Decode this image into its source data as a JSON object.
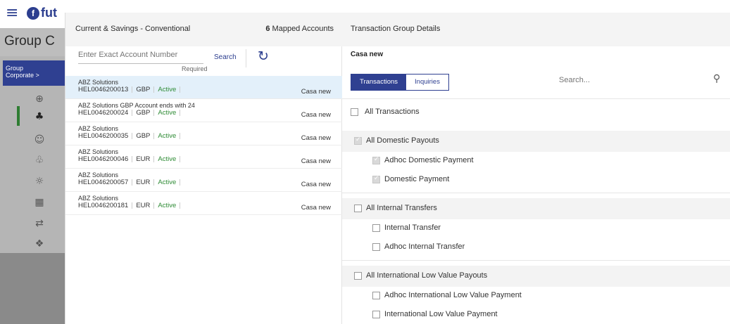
{
  "background": {
    "brand_text": "fut",
    "brand_mark": "f",
    "page_title": "Group C",
    "side_first_label_1": "Group",
    "side_first_label_2": "Corporate >",
    "side_icons": [
      "globe-icon",
      "users-icon",
      "user-badge-icon",
      "group-icon",
      "settings-icon",
      "calculator-icon",
      "transfer-icon",
      "puzzle-icon"
    ]
  },
  "left_pane": {
    "title": "Current & Savings - Conventional",
    "mapped_count": "6",
    "mapped_label": "Mapped Accounts",
    "account_input_placeholder": "Enter Exact Account Number",
    "required_label": "Required",
    "search_label": "Search",
    "accounts": [
      {
        "name": "ABZ Solutions",
        "number": "HEL0046200013",
        "currency": "GBP",
        "status": "Active",
        "group": "Casa new",
        "selected": true
      },
      {
        "name": "ABZ Solutions GBP Account ends with 24",
        "number": "HEL0046200024",
        "currency": "GBP",
        "status": "Active",
        "group": "Casa new",
        "selected": false
      },
      {
        "name": "ABZ Solutions",
        "number": "HEL0046200035",
        "currency": "GBP",
        "status": "Active",
        "group": "Casa new",
        "selected": false
      },
      {
        "name": "ABZ Solutions",
        "number": "HEL0046200046",
        "currency": "EUR",
        "status": "Active",
        "group": "Casa new",
        "selected": false
      },
      {
        "name": "ABZ Solutions",
        "number": "HEL0046200057",
        "currency": "EUR",
        "status": "Active",
        "group": "Casa new",
        "selected": false
      },
      {
        "name": "ABZ Solutions",
        "number": "HEL0046200181",
        "currency": "EUR",
        "status": "Active",
        "group": "Casa new",
        "selected": false
      }
    ]
  },
  "right_pane": {
    "title": "Transaction Group Details",
    "group_name": "Casa new",
    "tabs": [
      {
        "label": "Transactions",
        "active": true
      },
      {
        "label": "Inquiries",
        "active": false
      }
    ],
    "search_placeholder": "Search...",
    "all_transactions_label": "All Transactions",
    "domestic": {
      "label": "All Domestic Payouts",
      "checked": true,
      "items": [
        {
          "label": "Adhoc Domestic Payment",
          "checked": true
        },
        {
          "label": "Domestic Payment",
          "checked": true
        }
      ]
    },
    "internal": {
      "label": "All Internal Transfers",
      "checked": false,
      "items": [
        {
          "label": "Internal Transfer",
          "checked": false
        },
        {
          "label": "Adhoc Internal Transfer",
          "checked": false
        }
      ]
    },
    "international": {
      "label": "All International Low Value Payouts",
      "checked": false,
      "items": [
        {
          "label": "Adhoc International Low Value Payment",
          "checked": false
        },
        {
          "label": "International Low Value Payment",
          "checked": false
        }
      ]
    }
  },
  "colors": {
    "primary": "#2f4091",
    "status_active": "#2e8b35",
    "selected_row": "#e3f0fa"
  }
}
